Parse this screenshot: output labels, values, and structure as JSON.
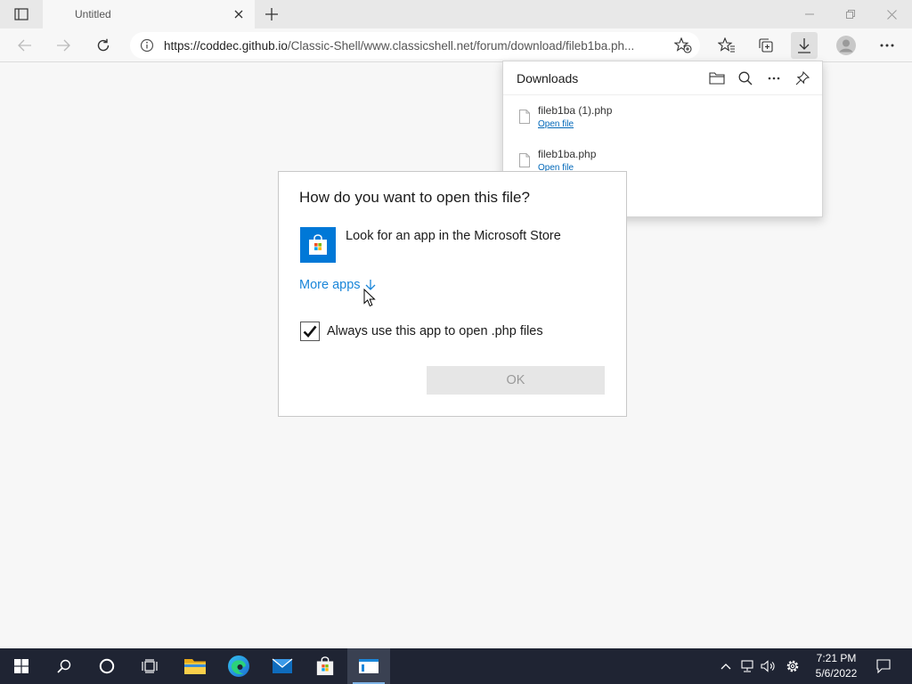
{
  "browser": {
    "tab_title": "Untitled",
    "url_host": "https://coddec.github.io",
    "url_path": "/Classic-Shell/www.classicshell.net/forum/download/fileb1ba.ph..."
  },
  "downloads": {
    "title": "Downloads",
    "items": [
      {
        "name": "fileb1ba (1).php",
        "action": "Open file"
      },
      {
        "name": "fileb1ba.php",
        "action": "Open file"
      }
    ]
  },
  "dialog": {
    "title": "How do you want to open this file?",
    "store_option": "Look for an app in the Microsoft Store",
    "more_apps": "More apps",
    "always_use": "Always use this app to open .php files",
    "always_checked": true,
    "ok_label": "OK"
  },
  "taskbar": {
    "time": "7:21 PM",
    "date": "5/6/2022"
  },
  "colors": {
    "accent": "#0078d7",
    "link": "#1a86d9",
    "taskbar": "#1f2433"
  }
}
